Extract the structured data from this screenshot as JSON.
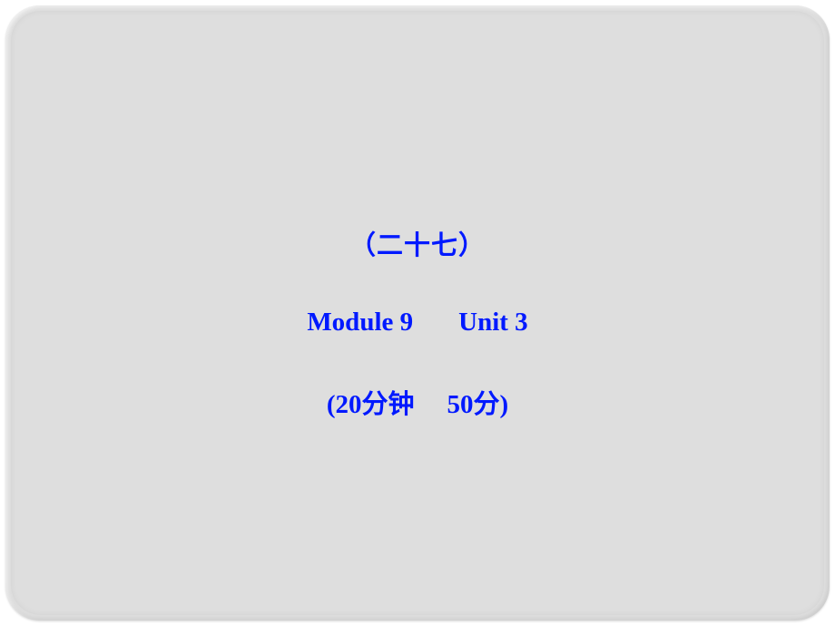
{
  "slide": {
    "line1": "（二十七）",
    "line2_part1": "Module 9",
    "line2_part2": "Unit 3",
    "line3_part1": "(20分钟",
    "line3_part2": "50分)"
  }
}
